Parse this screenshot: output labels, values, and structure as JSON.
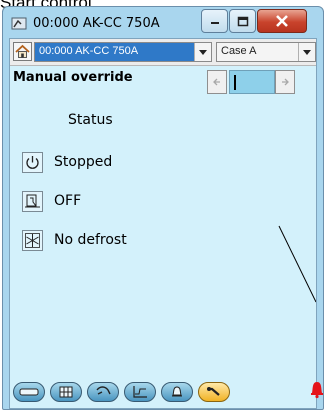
{
  "page_heading": "Start control",
  "window": {
    "title": "00:000 AK-CC 750A",
    "buttons": [
      "minimize-icon",
      "maximize-icon",
      "close-icon"
    ]
  },
  "toolbar": {
    "device_selector": "00:000 AK-CC 750A",
    "case_selector": "Case A"
  },
  "mode": {
    "label": "Manual override",
    "value": ""
  },
  "status_header": "Status",
  "status_items": [
    {
      "icon": "power-icon",
      "text": "Stopped"
    },
    {
      "icon": "valve-icon",
      "text": "OFF"
    },
    {
      "icon": "snowflake-icon",
      "text": "No defrost"
    }
  ],
  "bottom_tabs": [
    "cabinet-icon",
    "grid-icon",
    "tools-icon",
    "graph-icon",
    "bell-icon",
    "wrench-icon"
  ],
  "bottom_tabs_active": "wrench-icon",
  "alarm_icon": "alarm-bell-icon",
  "colors": {
    "window_frame": "#a9d6ee",
    "client_bg": "#d3f1fb",
    "active_tab": "#f1b225",
    "alarm": "#e4141a"
  }
}
